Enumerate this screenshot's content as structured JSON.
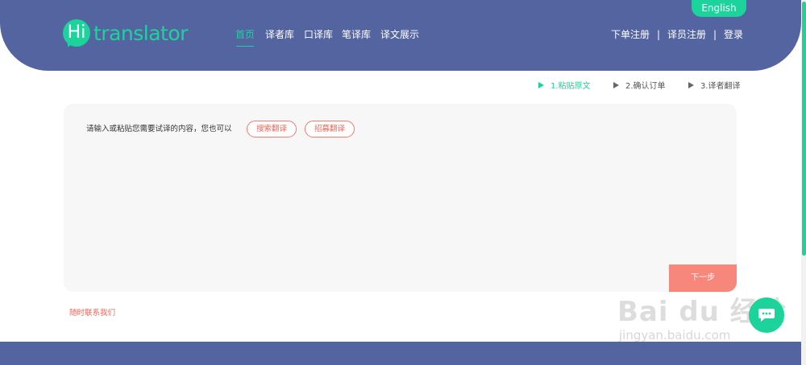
{
  "header": {
    "language_button": "English",
    "logo": {
      "hi": "Hi",
      "text": "translator"
    },
    "nav": [
      {
        "label": "首页",
        "active": true
      },
      {
        "label": "译者库",
        "active": false
      },
      {
        "label": "口译库",
        "active": false
      },
      {
        "label": "笔译库",
        "active": false
      },
      {
        "label": "译文展示",
        "active": false
      }
    ],
    "auth": {
      "order_register": "下单注册",
      "translator_register": "译员注册",
      "login": "登录",
      "separator": "|"
    }
  },
  "steps": [
    {
      "label": "1.粘贴原文",
      "active": true
    },
    {
      "label": "2.确认订单",
      "active": false
    },
    {
      "label": "3.译者翻译",
      "active": false
    }
  ],
  "panel": {
    "prompt": "请输入或粘贴您需要试译的内容，您也可以",
    "search_button": "搜索翻译",
    "recruit_button": "招募翻译",
    "next_button": "下一步"
  },
  "contact_link": "随时联系我们",
  "watermark": {
    "main": "Bai du 经验",
    "sub": "jingyan.baidu.com"
  },
  "colors": {
    "header_bg": "#5464a0",
    "accent_green": "#1cd39b",
    "accent_red": "#f0665a",
    "next_button_bg": "#f8877b"
  },
  "icons": {
    "chat": "chat-bubble-icon",
    "step_marker": "triangle-right-icon"
  }
}
